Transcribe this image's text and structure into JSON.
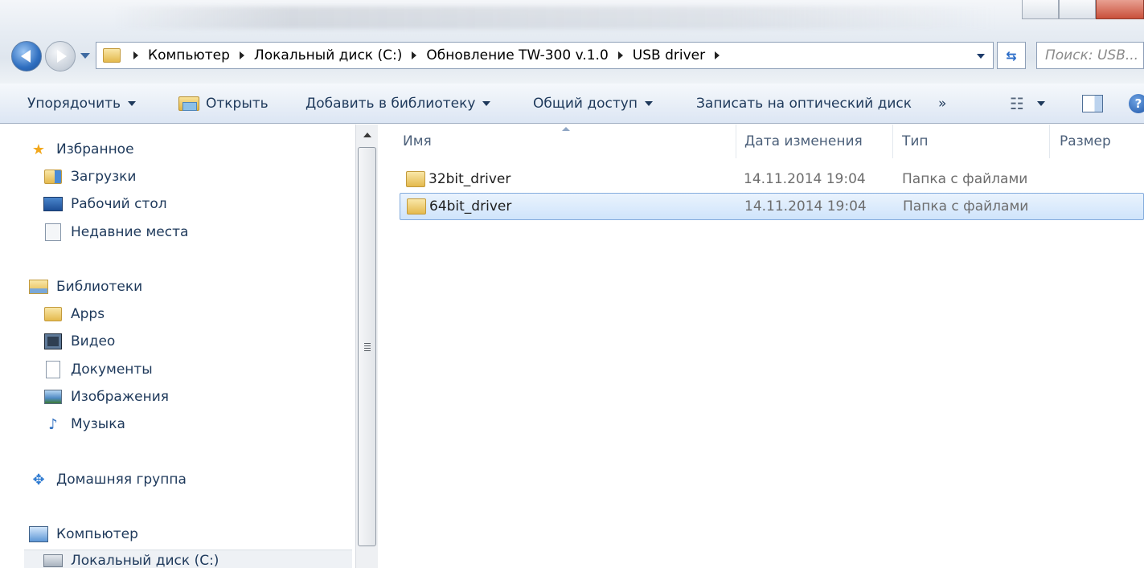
{
  "address": {
    "breadcrumbs": [
      "Компьютер",
      "Локальный диск (C:)",
      "Обновление TW-300 v.1.0",
      "USB driver"
    ],
    "search_placeholder": "Поиск: USB..."
  },
  "toolbar": {
    "organize": "Упорядочить",
    "open": "Открыть",
    "add_to_library": "Добавить в библиотеку",
    "share": "Общий доступ",
    "burn": "Записать на оптический диск",
    "more": "»"
  },
  "nav": {
    "favorites": "Избранное",
    "downloads": "Загрузки",
    "desktop": "Рабочий стол",
    "recent_places": "Недавние места",
    "libraries": "Библиотеки",
    "apps": "Apps",
    "video": "Видео",
    "documents": "Документы",
    "images": "Изображения",
    "music": "Музыка",
    "homegroup": "Домашняя группа",
    "computer": "Компьютер",
    "local_disk": "Локальный диск (C:)"
  },
  "columns": {
    "name": "Имя",
    "date_modified": "Дата изменения",
    "type": "Тип",
    "size": "Размер"
  },
  "files": [
    {
      "name": "32bit_driver",
      "date": "14.11.2014 19:04",
      "type": "Папка с файлами",
      "selected": false
    },
    {
      "name": "64bit_driver",
      "date": "14.11.2014 19:04",
      "type": "Папка с файлами",
      "selected": true
    }
  ],
  "icons": {
    "back": "back-arrow-icon",
    "forward": "forward-arrow-icon",
    "refresh": "refresh-icon",
    "help": "help-icon"
  },
  "colors": {
    "selection_bg": "#cfe4fb",
    "selection_border": "#84acdd",
    "nav_text": "#1e395b"
  }
}
